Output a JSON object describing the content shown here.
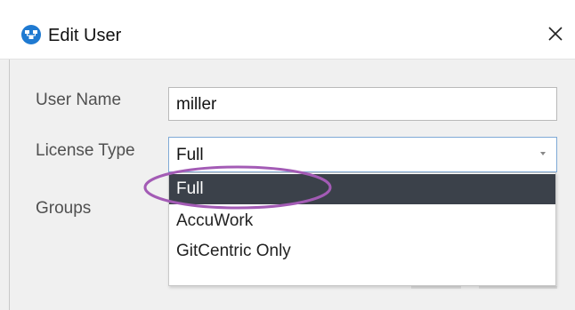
{
  "window": {
    "title": "Edit User",
    "icon": "app-icon",
    "close_icon": "close-icon"
  },
  "form": {
    "user_name_label": "User Name",
    "user_name_value": "miller",
    "license_type_label": "License Type",
    "license_type_value": "Full",
    "groups_label": "Groups"
  },
  "license_dropdown": {
    "options": [
      "Full",
      "AccuWork",
      "GitCentric Only"
    ],
    "selected": "Full"
  },
  "colors": {
    "accent": "#1f7ad1",
    "selected_bg": "#3b414a",
    "annotation": "#a35bb5"
  }
}
